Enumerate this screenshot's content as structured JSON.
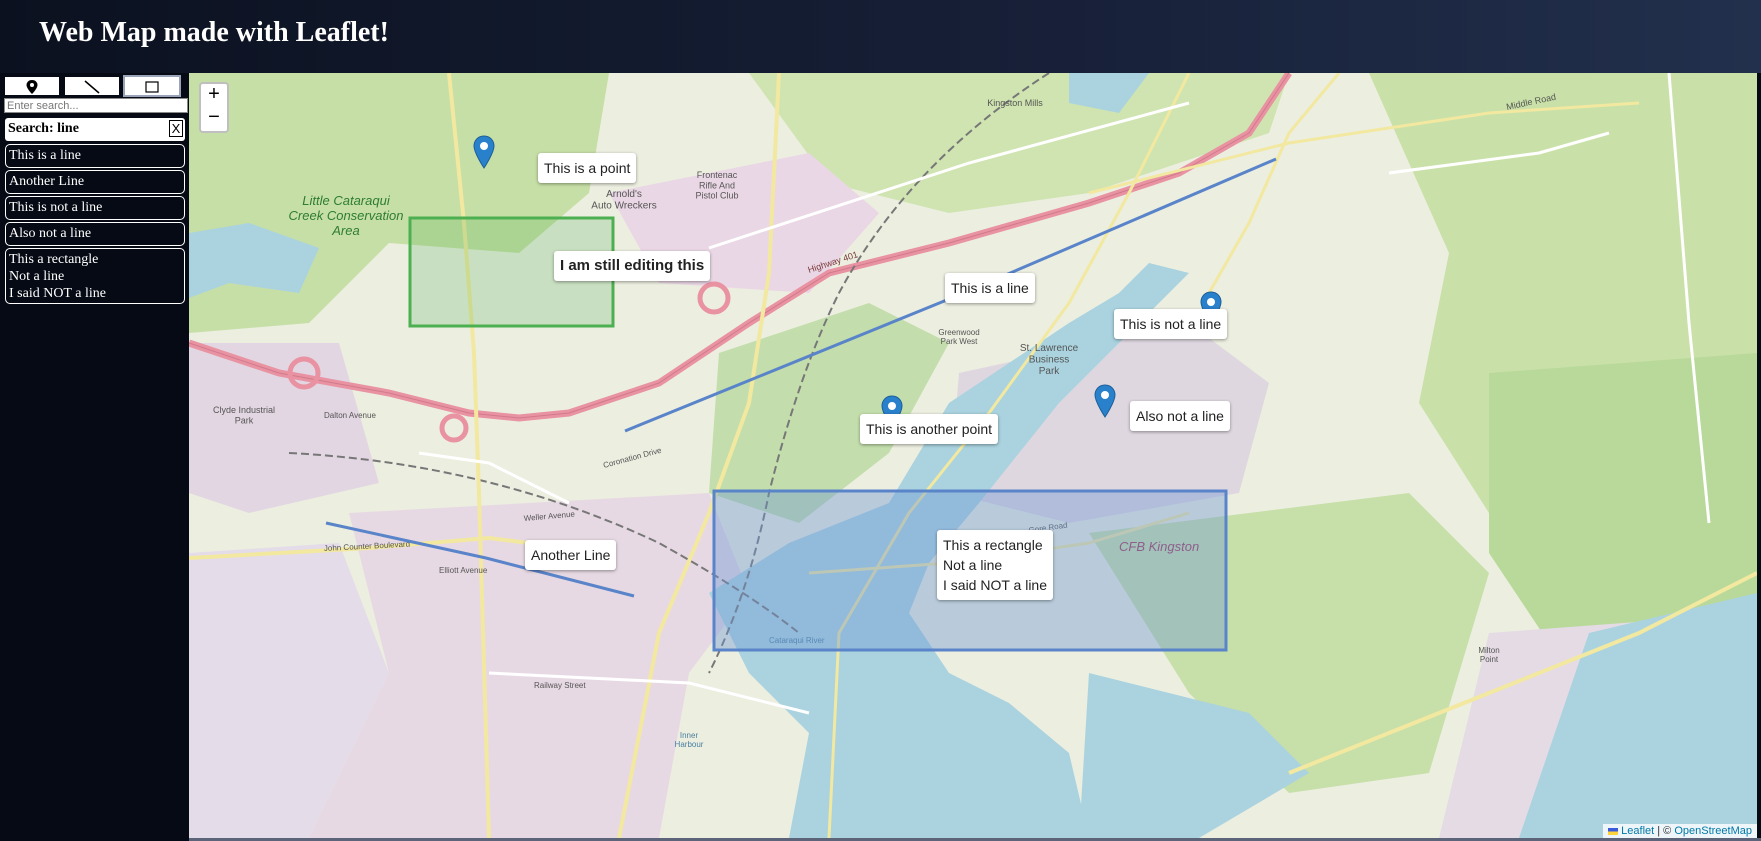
{
  "header": {
    "title": "Web Map made with Leaflet!"
  },
  "toolbar": {
    "tools": [
      {
        "name": "marker",
        "icon": "marker-icon"
      },
      {
        "name": "polyline",
        "icon": "line-icon"
      },
      {
        "name": "rectangle",
        "icon": "rectangle-icon",
        "active": true
      }
    ]
  },
  "search": {
    "placeholder": "Enter search...",
    "status": "Search: line",
    "clear_label": "X"
  },
  "results": [
    "This is a line",
    "Another Line",
    "This is not a line",
    "Also not a line",
    "This a rectangle\nNot a line\nI said NOT a line"
  ],
  "map": {
    "zoom_in": "+",
    "zoom_out": "−",
    "tooltips": {
      "point1": "This is a point",
      "editing": "I am still editing this",
      "line1": "This is a line",
      "not_line": "This is not a line",
      "another_point": "This is another point",
      "also_not": "Also not a line",
      "another_line": "Another Line",
      "rectangle": "This a rectangle\nNot a line\nI said NOT a line"
    },
    "attribution": {
      "leaflet": "Leaflet",
      "sep": " | © ",
      "osm": "OpenStreetMap"
    },
    "base_labels": {
      "conservation": "Little Cataraqui\nCreek Conservation\nArea",
      "arnolds": "Arnold's\nAuto Wreckers",
      "frontenac": "Frontenac\nRifle And\nPistol Club",
      "kingston_mills": "Kingston Mills",
      "middle_road": "Middle Road",
      "cfb": "CFB Kingston",
      "st_lawrence": "St. Lawrence\nBusiness\nPark",
      "greenwood": "Greenwood\nPark West",
      "clyde": "Clyde Industrial\nPark",
      "dalton": "Dalton Avenue",
      "highway401": "Highway 401",
      "john_counter": "John Counter Boulevard",
      "weller": "Weller Avenue",
      "elliott": "Elliott Avenue",
      "railway": "Railway Street",
      "milton": "Milton\nPoint",
      "cataraqui_river": "Cataraqui River",
      "inner_harbour": "Inner\nHarbour",
      "gore_road": "Gore Road",
      "coronation": "Coronation Drive"
    },
    "colors": {
      "line": "#5a84c9",
      "rectangle_fill": "#6f97d4",
      "editing_rect": "#4caf50",
      "marker": "#2a81cb"
    }
  }
}
